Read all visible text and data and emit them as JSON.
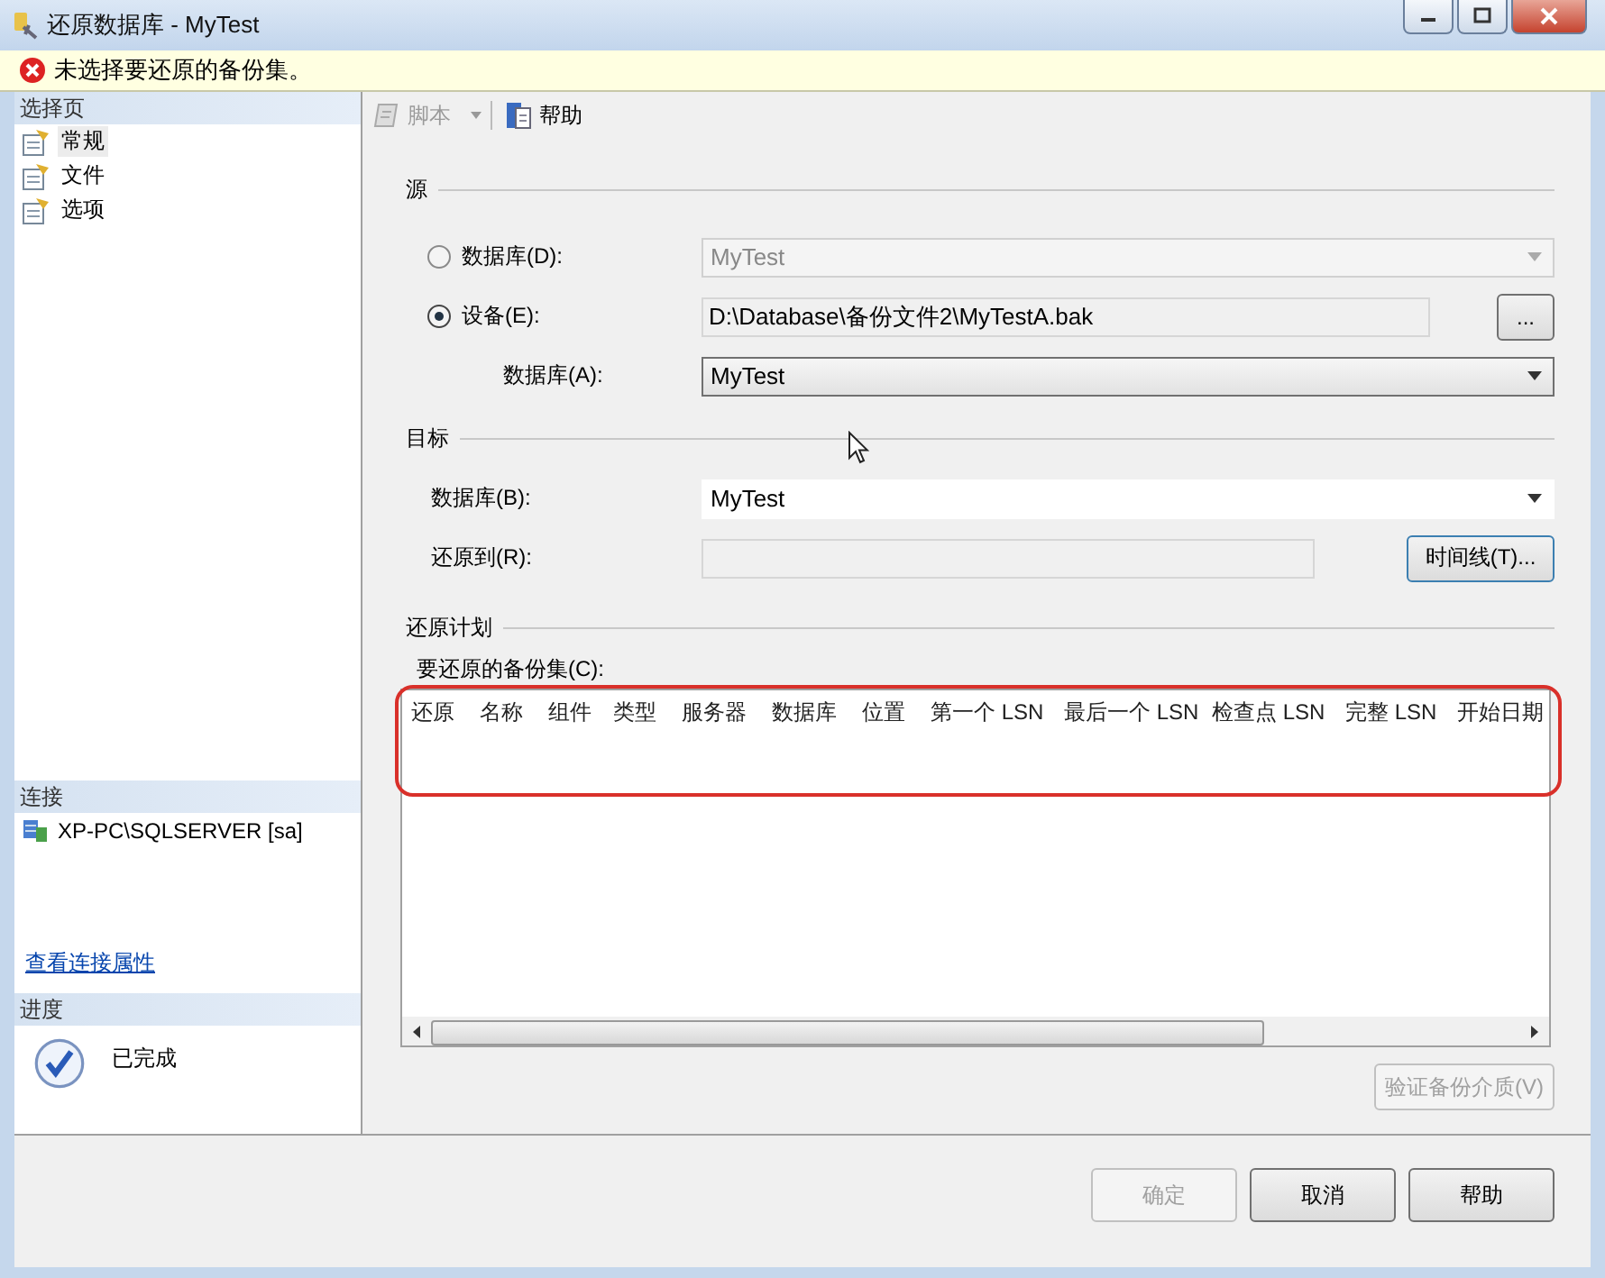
{
  "window": {
    "title": "还原数据库 - MyTest"
  },
  "error_bar": {
    "message": "未选择要还原的备份集。"
  },
  "sidebar": {
    "select_page": {
      "header": "选择页",
      "items": [
        {
          "label": "常规",
          "selected": true
        },
        {
          "label": "文件",
          "selected": false
        },
        {
          "label": "选项",
          "selected": false
        }
      ]
    },
    "connection": {
      "header": "连接",
      "server": "XP-PC\\SQLSERVER [sa]",
      "link": "查看连接属性"
    },
    "progress": {
      "header": "进度",
      "status": "已完成"
    }
  },
  "toolbar": {
    "items": [
      {
        "kind": "script",
        "label": "脚本",
        "disabled": true
      },
      {
        "kind": "help",
        "label": "帮助",
        "disabled": false
      }
    ]
  },
  "source": {
    "title": "源",
    "options": [
      {
        "kind": "dropdown",
        "label": "数据库(D):",
        "selected": false,
        "value": "MyTest"
      },
      {
        "kind": "path",
        "label": "设备(E):",
        "selected": true,
        "value": "D:\\Database\\备份文件2\\MyTestA.bak",
        "button": "..."
      }
    ],
    "database": {
      "label": "数据库(A):",
      "value": "MyTest"
    }
  },
  "destination": {
    "title": "目标",
    "database": {
      "label": "数据库(B):",
      "value": "MyTest"
    },
    "restore_to": {
      "label": "还原到(R):",
      "button": "时间线(T)..."
    }
  },
  "plan": {
    "title": "还原计划",
    "table_label": "要还原的备份集(C):",
    "columns": [
      "还原",
      "名称",
      "组件",
      "类型",
      "服务器",
      "数据库",
      "位置",
      "第一个 LSN",
      "最后一个 LSN",
      "检查点 LSN",
      "完整 LSN",
      "开始日期"
    ],
    "verify_button": {
      "label": "验证备份介质(V)",
      "disabled": true
    }
  },
  "footer": {
    "buttons": [
      {
        "label": "确定",
        "disabled": true
      },
      {
        "label": "取消",
        "disabled": false
      },
      {
        "label": "帮助",
        "disabled": false
      }
    ]
  }
}
